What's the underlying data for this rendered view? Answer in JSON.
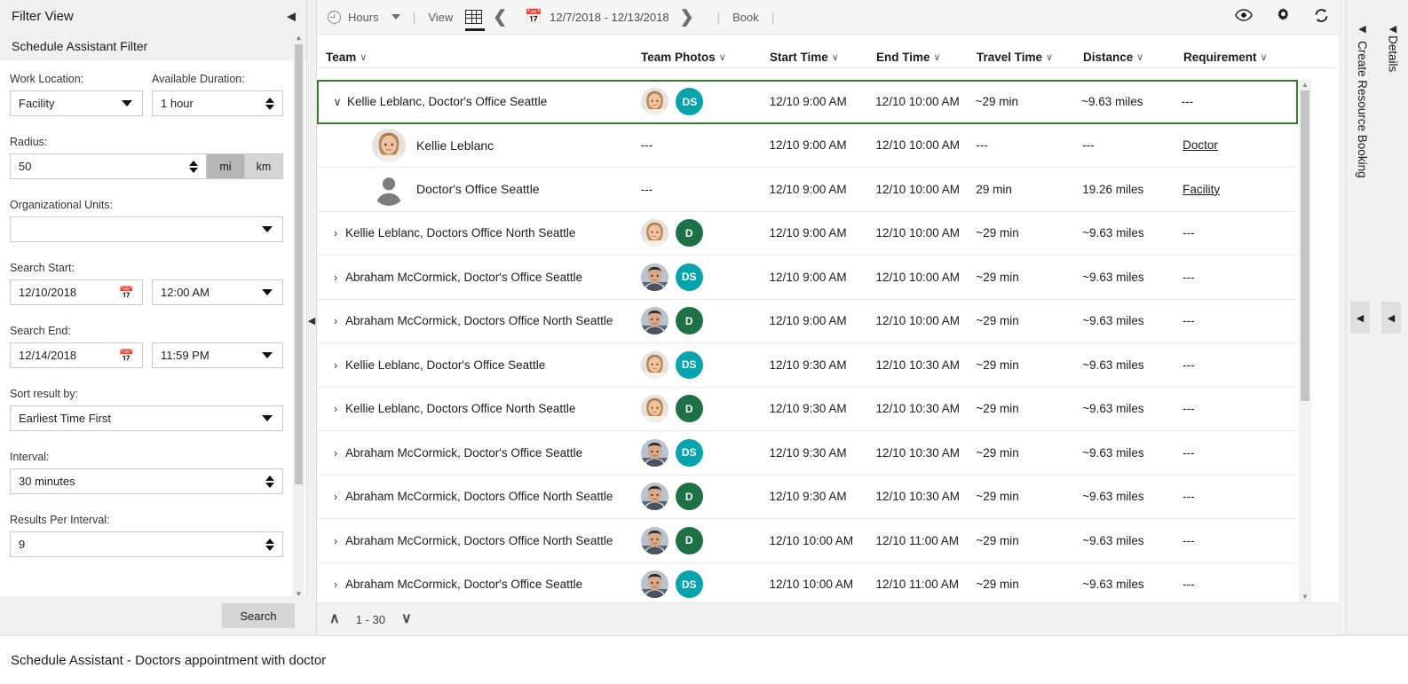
{
  "filter_panel": {
    "title": "Filter View",
    "subtitle": "Schedule Assistant Filter",
    "collapse_icon": "chevron-left-icon",
    "fields": {
      "work_location_label": "Work Location:",
      "work_location_value": "Facility",
      "available_duration_label": "Available Duration:",
      "available_duration_value": "1 hour",
      "radius_label": "Radius:",
      "radius_value": "50",
      "unit_mi": "mi",
      "unit_km": "km",
      "org_units_label": "Organizational Units:",
      "org_units_value": "",
      "search_start_label": "Search Start:",
      "search_start_date": "12/10/2018",
      "search_start_time": "12:00 AM",
      "search_end_label": "Search End:",
      "search_end_date": "12/14/2018",
      "search_end_time": "11:59 PM",
      "sort_label": "Sort result by:",
      "sort_value": "Earliest Time First",
      "interval_label": "Interval:",
      "interval_value": "30 minutes",
      "results_per_interval_label": "Results Per Interval:",
      "results_per_interval_value": "9"
    },
    "search_button": "Search"
  },
  "toolbar": {
    "hours_label": "Hours",
    "view_label": "View",
    "date_range": "12/7/2018 - 12/13/2018",
    "book_label": "Book",
    "sep": "|",
    "icons": {
      "clock": "clock-icon",
      "grid": "grid-view-icon",
      "prev": "chevron-left-icon",
      "next": "chevron-right-icon",
      "calendar": "calendar-icon",
      "eye": "eye-icon",
      "gear": "gear-icon",
      "refresh": "refresh-icon"
    },
    "eye_glyph": "\u0001",
    "gear_glyph": "⚙",
    "refresh_glyph": "↻",
    "prev_glyph": "‹",
    "next_glyph": "›",
    "calendar_glyph": "☷"
  },
  "grid": {
    "columns": [
      {
        "key": "team",
        "label": "Team"
      },
      {
        "key": "photos",
        "label": "Team Photos"
      },
      {
        "key": "start",
        "label": "Start Time"
      },
      {
        "key": "end",
        "label": "End Time"
      },
      {
        "key": "travel",
        "label": "Travel Time"
      },
      {
        "key": "distance",
        "label": "Distance"
      },
      {
        "key": "requirement",
        "label": "Requirement"
      }
    ],
    "sort_caret": "∨",
    "rows": [
      {
        "expanded": true,
        "selected": true,
        "team": "Kellie Leblanc, Doctor's Office Seattle",
        "avatar": "woman",
        "badge": "DS",
        "badge_color": "#08a4ad",
        "start": "12/10 9:00 AM",
        "end": "12/10 10:00 AM",
        "travel": "~29 min",
        "distance": "~9.63 miles",
        "requirement": "---"
      },
      {
        "child": true,
        "team": "Kellie Leblanc",
        "avatar": "woman",
        "photos": "---",
        "start": "12/10 9:00 AM",
        "end": "12/10 10:00 AM",
        "travel": "---",
        "distance": "---",
        "requirement": "Doctor",
        "requirement_link": true
      },
      {
        "child": true,
        "team": "Doctor's Office Seattle",
        "avatar": "generic",
        "photos": "---",
        "start": "12/10 9:00 AM",
        "end": "12/10 10:00 AM",
        "travel": "29 min",
        "distance": "19.26 miles",
        "requirement": "Facility",
        "requirement_link": true
      },
      {
        "team": "Kellie Leblanc, Doctors Office North Seattle",
        "avatar": "woman",
        "badge": "D",
        "badge_color": "#1e7145",
        "start": "12/10 9:00 AM",
        "end": "12/10 10:00 AM",
        "travel": "~29 min",
        "distance": "~9.63 miles",
        "requirement": "---"
      },
      {
        "team": "Abraham McCormick, Doctor's Office Seattle",
        "avatar": "man",
        "badge": "DS",
        "badge_color": "#08a4ad",
        "start": "12/10 9:00 AM",
        "end": "12/10 10:00 AM",
        "travel": "~29 min",
        "distance": "~9.63 miles",
        "requirement": "---"
      },
      {
        "team": "Abraham McCormick, Doctors Office North Seattle",
        "avatar": "man",
        "badge": "D",
        "badge_color": "#1e7145",
        "start": "12/10 9:00 AM",
        "end": "12/10 10:00 AM",
        "travel": "~29 min",
        "distance": "~9.63 miles",
        "requirement": "---"
      },
      {
        "team": "Kellie Leblanc, Doctor's Office Seattle",
        "avatar": "woman",
        "badge": "DS",
        "badge_color": "#08a4ad",
        "start": "12/10 9:30 AM",
        "end": "12/10 10:30 AM",
        "travel": "~29 min",
        "distance": "~9.63 miles",
        "requirement": "---"
      },
      {
        "team": "Kellie Leblanc, Doctors Office North Seattle",
        "avatar": "woman",
        "badge": "D",
        "badge_color": "#1e7145",
        "start": "12/10 9:30 AM",
        "end": "12/10 10:30 AM",
        "travel": "~29 min",
        "distance": "~9.63 miles",
        "requirement": "---"
      },
      {
        "team": "Abraham McCormick, Doctor's Office Seattle",
        "avatar": "man",
        "badge": "DS",
        "badge_color": "#08a4ad",
        "start": "12/10 9:30 AM",
        "end": "12/10 10:30 AM",
        "travel": "~29 min",
        "distance": "~9.63 miles",
        "requirement": "---"
      },
      {
        "team": "Abraham McCormick, Doctors Office North Seattle",
        "avatar": "man",
        "badge": "D",
        "badge_color": "#1e7145",
        "start": "12/10 9:30 AM",
        "end": "12/10 10:30 AM",
        "travel": "~29 min",
        "distance": "~9.63 miles",
        "requirement": "---"
      },
      {
        "team": "Abraham McCormick, Doctors Office North Seattle",
        "avatar": "man",
        "badge": "D",
        "badge_color": "#1e7145",
        "start": "12/10 10:00 AM",
        "end": "12/10 11:00 AM",
        "travel": "~29 min",
        "distance": "~9.63 miles",
        "requirement": "---"
      },
      {
        "team": "Abraham McCormick, Doctor's Office Seattle",
        "avatar": "man",
        "badge": "DS",
        "badge_color": "#08a4ad",
        "start": "12/10 10:00 AM",
        "end": "12/10 11:00 AM",
        "travel": "~29 min",
        "distance": "~9.63 miles",
        "requirement": "---"
      }
    ]
  },
  "pager": {
    "range": "1 - 30",
    "up_glyph": "∧",
    "down_glyph": "∨"
  },
  "rails": {
    "create_booking": "Create Resource Booking",
    "details": "Details",
    "arrow_glyph": "◀"
  },
  "statusbar": {
    "text": "Schedule Assistant - Doctors appointment with doctor"
  },
  "colors": {
    "selected_border": "#3a7d32",
    "badge_teal": "#08a4ad",
    "badge_green": "#1e7145",
    "panel_bg": "#f0f0f0"
  }
}
